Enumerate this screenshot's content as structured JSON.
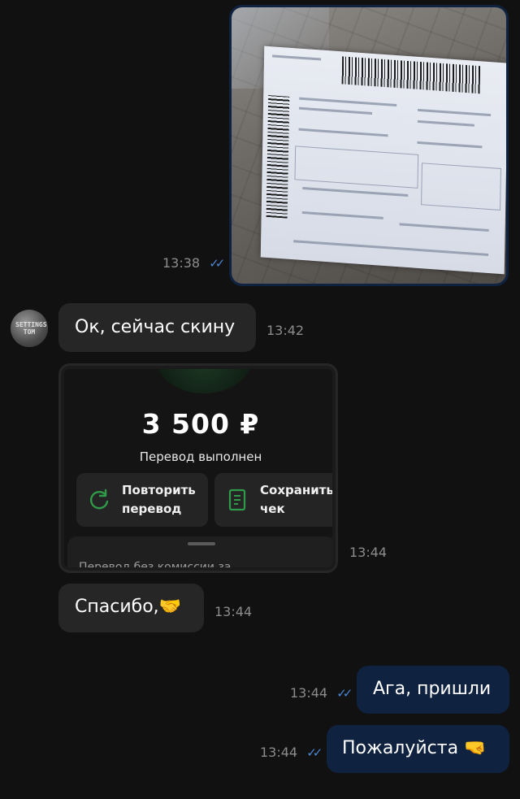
{
  "messages": {
    "photo_time": "13:38",
    "m1": {
      "text": "Ок, сейчас скину",
      "time": "13:42"
    },
    "receipt": {
      "amount": "3 500 ₽",
      "status": "Перевод выполнен",
      "repeat_label": "Повторить\nперевод",
      "save_label": "Сохранить\nчек",
      "bottom_text": "Перевод без комиссии за",
      "time": "13:44"
    },
    "m2": {
      "text": "Спасибо,",
      "emoji": "🤝",
      "time": "13:44"
    },
    "m3": {
      "text": "Ага, пришли",
      "time": "13:44"
    },
    "m4": {
      "text": "Пожалуйста",
      "emoji": "🤜",
      "time": "13:44"
    }
  },
  "avatar": {
    "text": "SETTINGS\nTOM"
  },
  "read_ticks": "✓✓",
  "colors": {
    "background": "#111111",
    "incoming_bubble": "#262626",
    "outgoing_bubble": "#0f2240",
    "read_tick": "#4a86d4",
    "green_icon": "#2f9a48"
  }
}
